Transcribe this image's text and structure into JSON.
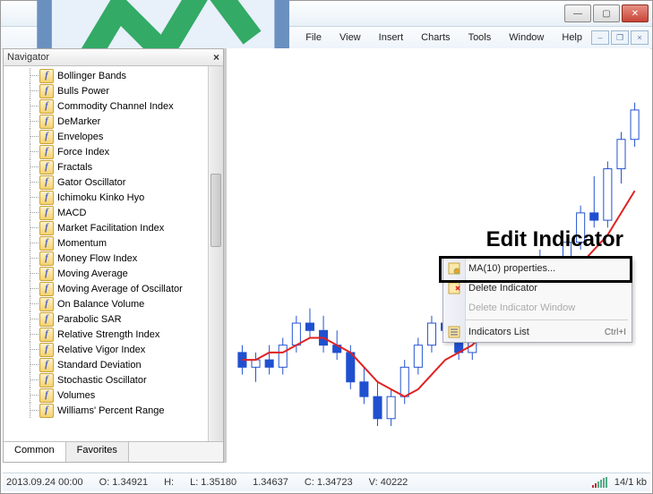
{
  "menu": {
    "file": "File",
    "view": "View",
    "insert": "Insert",
    "charts": "Charts",
    "tools": "Tools",
    "window": "Window",
    "help": "Help"
  },
  "navigator": {
    "title": "Navigator",
    "tabs": {
      "common": "Common",
      "favorites": "Favorites"
    },
    "items": [
      "Bollinger Bands",
      "Bulls Power",
      "Commodity Channel Index",
      "DeMarker",
      "Envelopes",
      "Force Index",
      "Fractals",
      "Gator Oscillator",
      "Ichimoku Kinko Hyo",
      "MACD",
      "Market Facilitation Index",
      "Momentum",
      "Money Flow Index",
      "Moving Average",
      "Moving Average of Oscillator",
      "On Balance Volume",
      "Parabolic SAR",
      "Relative Strength Index",
      "Relative Vigor Index",
      "Standard Deviation",
      "Stochastic Oscillator",
      "Volumes",
      "Williams' Percent Range"
    ]
  },
  "annotation": {
    "label": "Edit Indicator"
  },
  "context_menu": {
    "properties": "MA(10) properties...",
    "delete": "Delete Indicator",
    "delete_window": "Delete Indicator Window",
    "list": "Indicators List",
    "list_shortcut": "Ctrl+I"
  },
  "status": {
    "date": "2013.09.24 00:00",
    "open": "O: 1.34921",
    "high": "H: ",
    "low": "L: 1.35180",
    "last": "1.34637",
    "close": "C: 1.34723",
    "volume": "V: 40222",
    "kb": "14/1 kb"
  },
  "chart_data": {
    "type": "candlestick",
    "title": "",
    "indicator": "MA(10)",
    "candles": [
      {
        "o": 1.35,
        "h": 1.351,
        "l": 1.347,
        "c": 1.348,
        "color": "down"
      },
      {
        "o": 1.348,
        "h": 1.35,
        "l": 1.346,
        "c": 1.349,
        "color": "up"
      },
      {
        "o": 1.349,
        "h": 1.351,
        "l": 1.347,
        "c": 1.348,
        "color": "down"
      },
      {
        "o": 1.348,
        "h": 1.352,
        "l": 1.347,
        "c": 1.351,
        "color": "up"
      },
      {
        "o": 1.351,
        "h": 1.355,
        "l": 1.35,
        "c": 1.354,
        "color": "up"
      },
      {
        "o": 1.354,
        "h": 1.356,
        "l": 1.352,
        "c": 1.353,
        "color": "down"
      },
      {
        "o": 1.353,
        "h": 1.355,
        "l": 1.35,
        "c": 1.351,
        "color": "down"
      },
      {
        "o": 1.351,
        "h": 1.353,
        "l": 1.349,
        "c": 1.35,
        "color": "down"
      },
      {
        "o": 1.35,
        "h": 1.351,
        "l": 1.345,
        "c": 1.346,
        "color": "down"
      },
      {
        "o": 1.346,
        "h": 1.348,
        "l": 1.343,
        "c": 1.344,
        "color": "down"
      },
      {
        "o": 1.344,
        "h": 1.346,
        "l": 1.34,
        "c": 1.341,
        "color": "down"
      },
      {
        "o": 1.341,
        "h": 1.345,
        "l": 1.34,
        "c": 1.344,
        "color": "up"
      },
      {
        "o": 1.344,
        "h": 1.349,
        "l": 1.343,
        "c": 1.348,
        "color": "up"
      },
      {
        "o": 1.348,
        "h": 1.352,
        "l": 1.347,
        "c": 1.351,
        "color": "up"
      },
      {
        "o": 1.351,
        "h": 1.355,
        "l": 1.35,
        "c": 1.354,
        "color": "up"
      },
      {
        "o": 1.354,
        "h": 1.356,
        "l": 1.352,
        "c": 1.353,
        "color": "down"
      },
      {
        "o": 1.353,
        "h": 1.354,
        "l": 1.349,
        "c": 1.35,
        "color": "down"
      },
      {
        "o": 1.35,
        "h": 1.358,
        "l": 1.349,
        "c": 1.357,
        "color": "up"
      },
      {
        "o": 1.357,
        "h": 1.362,
        "l": 1.356,
        "c": 1.361,
        "color": "up"
      },
      {
        "o": 1.361,
        "h": 1.363,
        "l": 1.358,
        "c": 1.359,
        "color": "down"
      },
      {
        "o": 1.359,
        "h": 1.362,
        "l": 1.357,
        "c": 1.358,
        "color": "down"
      },
      {
        "o": 1.358,
        "h": 1.363,
        "l": 1.357,
        "c": 1.362,
        "color": "up"
      },
      {
        "o": 1.362,
        "h": 1.364,
        "l": 1.359,
        "c": 1.36,
        "color": "down"
      },
      {
        "o": 1.36,
        "h": 1.363,
        "l": 1.358,
        "c": 1.362,
        "color": "up"
      },
      {
        "o": 1.362,
        "h": 1.366,
        "l": 1.361,
        "c": 1.365,
        "color": "up"
      },
      {
        "o": 1.365,
        "h": 1.37,
        "l": 1.364,
        "c": 1.369,
        "color": "up"
      },
      {
        "o": 1.369,
        "h": 1.374,
        "l": 1.367,
        "c": 1.368,
        "color": "down"
      },
      {
        "o": 1.368,
        "h": 1.376,
        "l": 1.367,
        "c": 1.375,
        "color": "up"
      },
      {
        "o": 1.375,
        "h": 1.38,
        "l": 1.373,
        "c": 1.379,
        "color": "up"
      },
      {
        "o": 1.379,
        "h": 1.384,
        "l": 1.378,
        "c": 1.383,
        "color": "up"
      }
    ],
    "ma_line": [
      1.349,
      1.349,
      1.35,
      1.35,
      1.351,
      1.352,
      1.352,
      1.351,
      1.35,
      1.348,
      1.346,
      1.345,
      1.344,
      1.345,
      1.347,
      1.349,
      1.35,
      1.351,
      1.353,
      1.355,
      1.356,
      1.357,
      1.358,
      1.359,
      1.36,
      1.362,
      1.364,
      1.366,
      1.369,
      1.372
    ],
    "y_range": [
      1.338,
      1.386
    ]
  }
}
